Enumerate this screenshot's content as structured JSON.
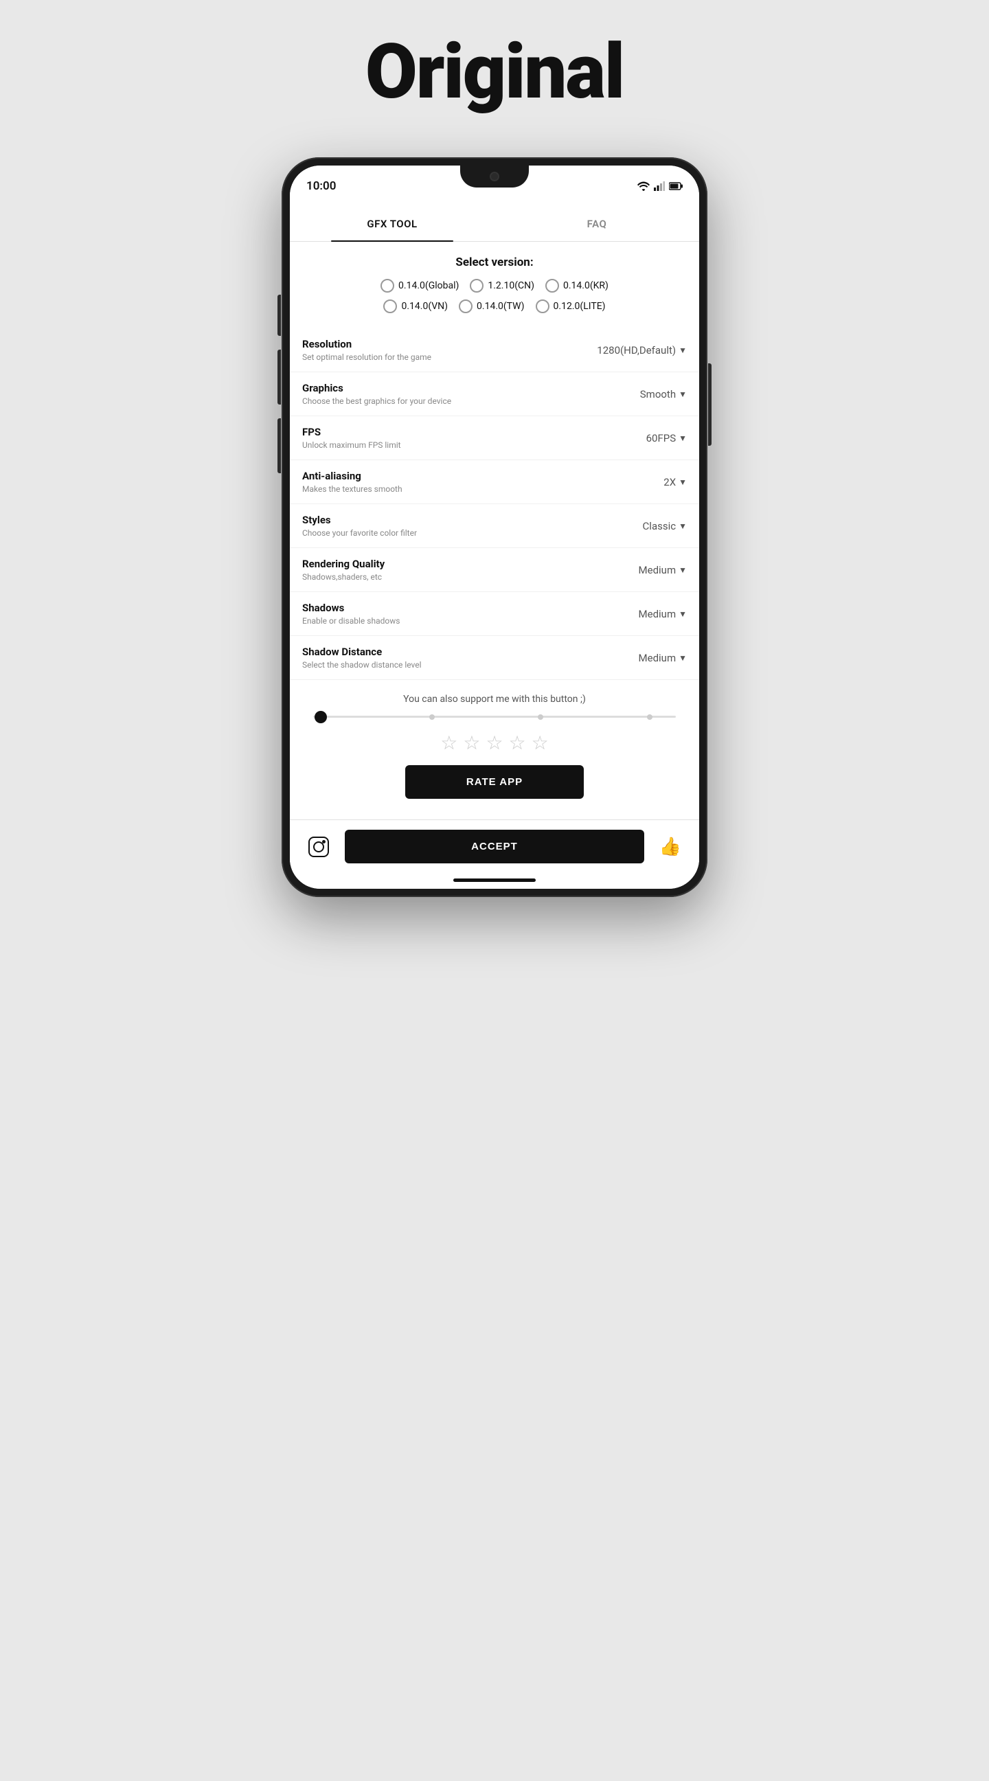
{
  "page": {
    "title": "Original"
  },
  "tabs": {
    "items": [
      {
        "label": "GFX TOOL",
        "active": true
      },
      {
        "label": "FAQ",
        "active": false
      }
    ]
  },
  "version": {
    "title": "Select version:",
    "options": [
      {
        "label": "0.14.0(Global)",
        "selected": false
      },
      {
        "label": "1.2.10(CN)",
        "selected": false
      },
      {
        "label": "0.14.0(KR)",
        "selected": false
      },
      {
        "label": "0.14.0(VN)",
        "selected": false
      },
      {
        "label": "0.14.0(TW)",
        "selected": false
      },
      {
        "label": "0.12.0(LITE)",
        "selected": false
      }
    ]
  },
  "settings": [
    {
      "title": "Resolution",
      "subtitle": "Set optimal resolution for the game",
      "value": "1280(HD,Default)"
    },
    {
      "title": "Graphics",
      "subtitle": "Choose the best graphics for your device",
      "value": "Smooth"
    },
    {
      "title": "FPS",
      "subtitle": "Unlock maximum FPS limit",
      "value": "60FPS"
    },
    {
      "title": "Anti-aliasing",
      "subtitle": "Makes the textures smooth",
      "value": "2X"
    },
    {
      "title": "Styles",
      "subtitle": "Choose your favorite color filter",
      "value": "Classic"
    },
    {
      "title": "Rendering Quality",
      "subtitle": "Shadows,shaders, etc",
      "value": "Medium"
    },
    {
      "title": "Shadows",
      "subtitle": "Enable or disable shadows",
      "value": "Medium"
    },
    {
      "title": "Shadow Distance",
      "subtitle": "Select the shadow distance level",
      "value": "Medium"
    }
  ],
  "support": {
    "text": "You can also support me with this button ;)"
  },
  "rating": {
    "stars": [
      "☆",
      "☆",
      "☆",
      "☆",
      "☆"
    ]
  },
  "buttons": {
    "rate_app": "RATE APP",
    "accept": "ACCEPT"
  },
  "status_bar": {
    "time": "10:00"
  }
}
